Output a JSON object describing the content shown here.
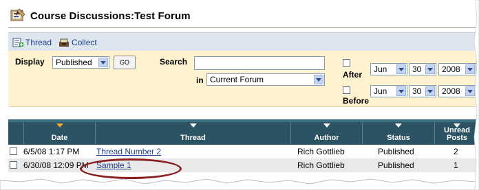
{
  "title": "Course Discussions:Test Forum",
  "toolbar": {
    "thread_label": "Thread",
    "collect_label": "Collect"
  },
  "filter": {
    "display_label": "Display",
    "display_value": "Published",
    "go_label": "GO",
    "search_label": "Search",
    "search_value": "",
    "in_label": "in",
    "scope_value": "Current Forum",
    "after_label": "After",
    "before_label": "Before",
    "after_date": {
      "month": "Jun",
      "day": "30",
      "year": "2008"
    },
    "before_date": {
      "month": "Jun",
      "day": "30",
      "year": "2008"
    }
  },
  "table": {
    "columns": [
      "Date",
      "Thread",
      "Author",
      "Status",
      "Unread Posts"
    ],
    "unread_line1": "Unread",
    "unread_line2": "Posts",
    "rows": [
      {
        "date": "6/5/08 1:17 PM",
        "thread": "Thread Number 2",
        "author": "Rich Gottlieb",
        "status": "Published",
        "unread": "2"
      },
      {
        "date": "6/30/08 12:09 PM",
        "thread": "Sample 1",
        "author": "Rich Gottlieb",
        "status": "Published",
        "unread": "1"
      }
    ]
  },
  "colors": {
    "header_bg": "#2c5363",
    "sorted_arrow": "#f2a833",
    "filter_bg": "#fff3cf",
    "toolbar_bg": "#dde6ef",
    "highlight_oval": "#8b1e1e"
  }
}
